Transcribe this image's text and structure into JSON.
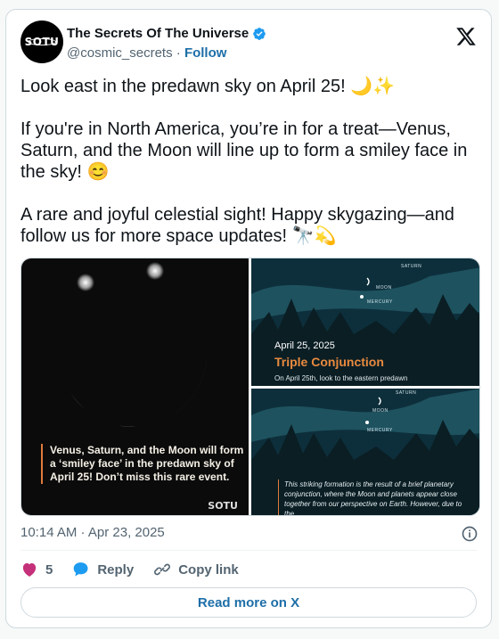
{
  "account": {
    "display_name": "The Secrets Of The Universe",
    "handle": "@cosmic_secrets",
    "separator": "·",
    "follow_label": "Follow",
    "avatar_text": "SOTU"
  },
  "tweet": {
    "paragraphs": [
      "Look east in the predawn sky on April 25! 🌙✨",
      "If you're in North America, you’re in for a treat—Venus, Saturn, and the Moon will line up to form a smiley face in the sky! 😊",
      "A rare and joyful celestial sight! Happy skygazing—and follow us for more space updates! 🔭💫"
    ]
  },
  "media": {
    "left": {
      "caption": "Venus, Saturn, and the Moon will form a ‘smiley face’ in the predawn sky of April 25! Don’t miss this rare event.",
      "watermark": "SOTU"
    },
    "top_right": {
      "date": "April 25, 2025",
      "title": "Triple Conjunction",
      "subtitle": "On April 25th, look to the eastern predawn",
      "labels": [
        "SATURN",
        "MOON",
        "MERCURY"
      ]
    },
    "bottom_right": {
      "text": "This striking formation is the result of a brief planetary conjunction, where the Moon and planets appear close together from our perspective on Earth. However, due to the",
      "labels": [
        "SATURN",
        "MOON",
        "MERCURY"
      ]
    }
  },
  "meta": {
    "timestamp": "10:14 AM · Apr 23, 2025"
  },
  "actions": {
    "like_count": "5",
    "reply_label": "Reply",
    "copy_link_label": "Copy link"
  },
  "read_more_label": "Read more on X",
  "colors": {
    "link_blue": "#1d6ea8",
    "like_pink": "#c4307a",
    "accent_orange": "#e88a3f",
    "border": "#cfd9de"
  }
}
